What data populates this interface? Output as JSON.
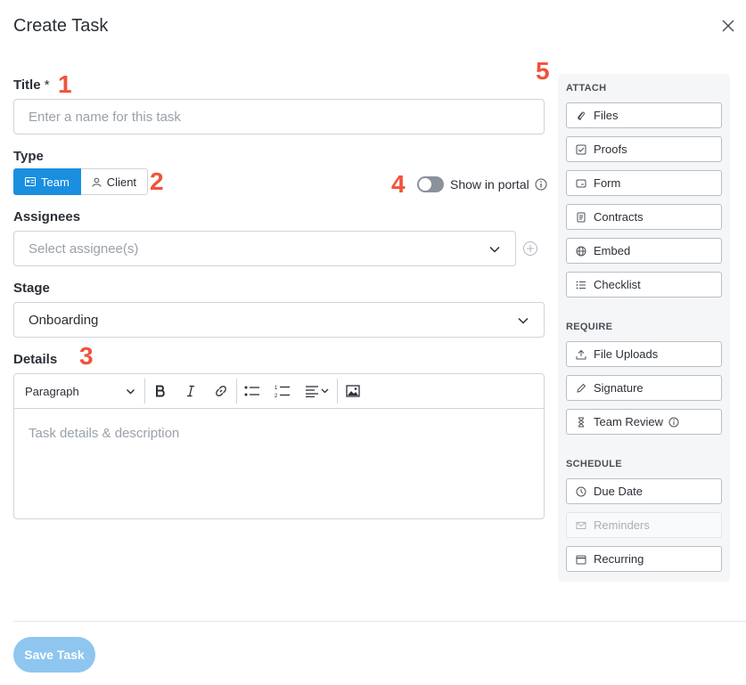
{
  "header": {
    "title": "Create Task"
  },
  "markers": [
    "1",
    "2",
    "3",
    "4",
    "5"
  ],
  "title_field": {
    "label": "Title",
    "required_mark": "*",
    "placeholder": "Enter a name for this task"
  },
  "type_field": {
    "label": "Type",
    "options": [
      "Team",
      "Client"
    ],
    "selected": "Team"
  },
  "portal": {
    "label": "Show in portal",
    "enabled": false
  },
  "assignees": {
    "label": "Assignees",
    "placeholder": "Select assignee(s)"
  },
  "stage": {
    "label": "Stage",
    "value": "Onboarding"
  },
  "details": {
    "label": "Details",
    "paragraph": "Paragraph",
    "placeholder": "Task details & description"
  },
  "footer": {
    "save_label": "Save Task"
  },
  "panel": {
    "attach": {
      "heading": "ATTACH",
      "items": [
        "Files",
        "Proofs",
        "Form",
        "Contracts",
        "Embed",
        "Checklist"
      ]
    },
    "require": {
      "heading": "REQUIRE",
      "items": [
        "File Uploads",
        "Signature",
        "Team Review"
      ]
    },
    "schedule": {
      "heading": "SCHEDULE",
      "items": [
        "Due Date",
        "Reminders",
        "Recurring"
      ]
    }
  },
  "colors": {
    "primary": "#1a8fe0",
    "save_button": "#8ec6f0",
    "marker": "#f0533b",
    "panel_bg": "#f5f6f8"
  }
}
